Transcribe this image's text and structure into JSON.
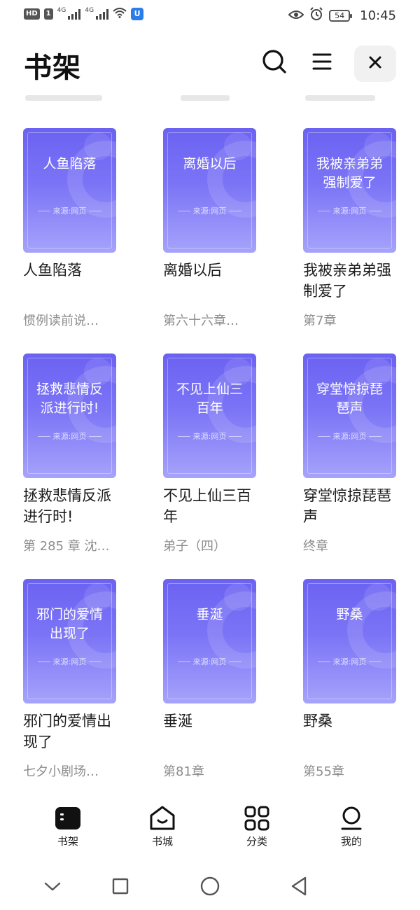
{
  "status_bar": {
    "hd_label": "HD",
    "sim_label": "1",
    "net1": "4G",
    "net2": "4G",
    "battery": "54",
    "time": "10:45"
  },
  "header": {
    "title": "书架"
  },
  "books": [
    {
      "cover_title": "人鱼陷落",
      "source": "来源:网页",
      "title": "人鱼陷落",
      "progress": "惯例读前说…"
    },
    {
      "cover_title": "离婚以后",
      "source": "来源:网页",
      "title": "离婚以后",
      "progress": "第六十六章…"
    },
    {
      "cover_title": "我被亲弟弟强制爱了",
      "source": "来源:网页",
      "title": "我被亲弟弟强制爱了",
      "progress": "第7章"
    },
    {
      "cover_title": "拯救悲情反派进行时!",
      "source": "来源:网页",
      "title": "拯救悲情反派进行时!",
      "progress": "第 285 章 沈…"
    },
    {
      "cover_title": "不见上仙三百年",
      "source": "来源:网页",
      "title": "不见上仙三百年",
      "progress": "弟子（四）"
    },
    {
      "cover_title": "穿堂惊掠琵琶声",
      "source": "来源:网页",
      "title": "穿堂惊掠琵琶声",
      "progress": "终章"
    },
    {
      "cover_title": "邪门的爱情出现了",
      "source": "来源:网页",
      "title": "邪门的爱情出现了",
      "progress": "七夕小剧场…"
    },
    {
      "cover_title": "垂涎",
      "source": "来源:网页",
      "title": "垂涎",
      "progress": "第81章"
    },
    {
      "cover_title": "野桑",
      "source": "来源:网页",
      "title": "野桑",
      "progress": "第55章"
    }
  ],
  "bottom_nav": [
    {
      "label": "书架",
      "icon": "bookshelf-icon",
      "active": true
    },
    {
      "label": "书城",
      "icon": "store-icon",
      "active": false
    },
    {
      "label": "分类",
      "icon": "category-icon",
      "active": false
    },
    {
      "label": "我的",
      "icon": "profile-icon",
      "active": false
    }
  ],
  "colors": {
    "cover_top": "#6b62f2",
    "cover_bottom": "#a6a3fb",
    "text_primary": "#1a1a1a",
    "text_secondary": "#8c8c8c"
  }
}
